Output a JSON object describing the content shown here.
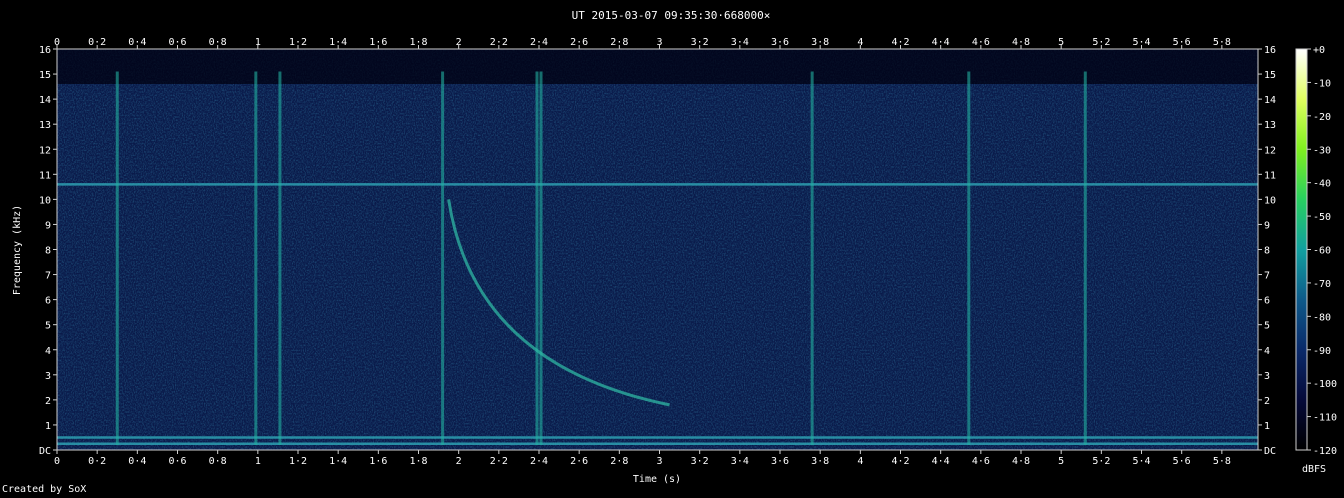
{
  "title": "UT 2015-03-07 09:35:30·668000×",
  "credit": "Created by SoX",
  "chart_data": {
    "type": "heatmap",
    "title": "UT 2015-03-07 09:35:30·668000×",
    "xlabel": "Time (s)",
    "ylabel": "Frequency (kHz)",
    "x_ticks": [
      "0",
      "0·2",
      "0·4",
      "0·6",
      "0·8",
      "1",
      "1·2",
      "1·4",
      "1·6",
      "1·8",
      "2",
      "2·2",
      "2·4",
      "2·6",
      "2·8",
      "3",
      "3·2",
      "3·4",
      "3·6",
      "3·8",
      "4",
      "4·2",
      "4·4",
      "4·6",
      "4·8",
      "5",
      "5·2",
      "5·4",
      "5·6",
      "5·8"
    ],
    "y_ticks": [
      "DC",
      "1",
      "2",
      "3",
      "4",
      "5",
      "6",
      "7",
      "8",
      "9",
      "10",
      "11",
      "12",
      "13",
      "14",
      "15",
      "16"
    ],
    "xlim": [
      0,
      5.98
    ],
    "ylim": [
      0,
      16
    ],
    "colorbar": {
      "label": "dBFS",
      "ticks": [
        "+0",
        "-10",
        "-20",
        "-30",
        "-40",
        "-50",
        "-60",
        "-70",
        "-80",
        "-90",
        "-100",
        "-110",
        "-120"
      ],
      "range": [
        -120,
        0
      ],
      "colors": [
        "#000000",
        "#050a3a",
        "#0a2a6a",
        "#0e5a8a",
        "#12a0a0",
        "#28d060",
        "#80f020",
        "#e0ff60",
        "#ffffff"
      ]
    },
    "background_color": "#0a1a4a",
    "tonal_lines_khz": [
      10.6,
      0.5,
      0.25
    ],
    "impulses_s": [
      0.3,
      0.99,
      1.11,
      1.92,
      2.39,
      2.41,
      3.76,
      4.54,
      5.12
    ],
    "whistler": {
      "start": [
        1.95,
        10.0
      ],
      "end": [
        3.05,
        1.8
      ]
    }
  }
}
